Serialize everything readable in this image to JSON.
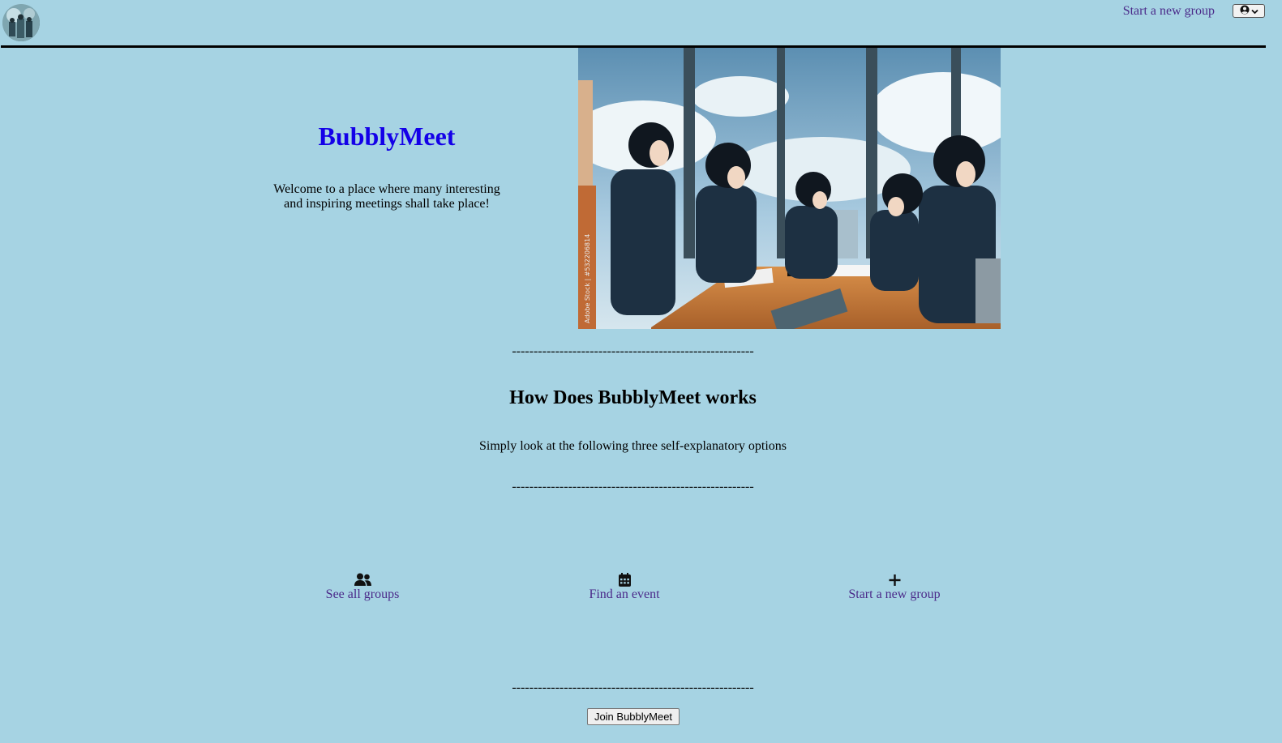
{
  "header": {
    "logo_icon": "bubblymeet-logo-avatar",
    "start_group_link": "Start a new group",
    "user_menu_icon": "user-circle-icon",
    "user_menu_chevron": "chevron-down-icon"
  },
  "hero": {
    "title": "BubblyMeet",
    "welcome_text": "Welcome to a place where many interesting and inspiring meetings shall take place!",
    "image_description_icon": "meeting-room-illustration",
    "image_watermark": "Adobe Stock | #532206814"
  },
  "how_it_works": {
    "separator": "--------------------------------------------------------",
    "title": "How Does BubblyMeet works",
    "subtitle": "Simply look at the following three self-explanatory options"
  },
  "options": [
    {
      "icon": "users-icon",
      "label": "See all groups"
    },
    {
      "icon": "calendar-icon",
      "label": "Find an event"
    },
    {
      "icon": "plus-icon",
      "label": "Start a new group"
    }
  ],
  "footer": {
    "separator": "--------------------------------------------------------",
    "join_button": "Join BubblyMeet"
  },
  "colors": {
    "background": "#a6d3e3",
    "title_blue": "#1400e8",
    "link_purple": "#4b2a8a"
  }
}
